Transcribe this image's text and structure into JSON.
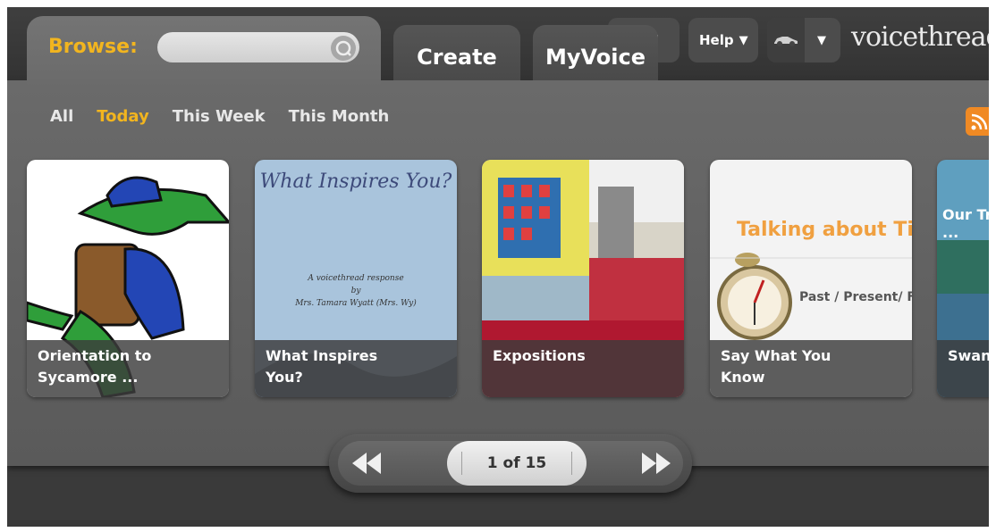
{
  "header": {
    "browse_label": "Browse:",
    "search_value": "",
    "tabs": [
      {
        "label": "Create"
      },
      {
        "label": "MyVoice"
      }
    ],
    "hidden_pill_fragment": "!",
    "help_label": "Help",
    "logo_text": "voicethread"
  },
  "filters": [
    {
      "label": "All",
      "active": false
    },
    {
      "label": "Today",
      "active": true
    },
    {
      "label": "This Week",
      "active": false
    },
    {
      "label": "This Month",
      "active": false
    }
  ],
  "threads": [
    {
      "title": "Orientation to\n Sycamore ...",
      "thumb": "alligator-mascot-thumbnail"
    },
    {
      "title": "What Inspires\n You?",
      "thumb": "what-inspires-you-slide",
      "slide_title": "What Inspires You?",
      "slide_sub1": "A voicethread response",
      "slide_sub2": "by",
      "slide_sub3": "Mrs. Tamara Wyatt (Mrs. Wy)"
    },
    {
      "title": "Expositions",
      "thumb": "classroom-store-photo"
    },
    {
      "title": "Say What You\n Know",
      "thumb": "talking-about-time-slide",
      "slide_title": "Talking about Tir",
      "slide_sub": "Past / Present/ F"
    },
    {
      "title": "Swan",
      "thumb": "lake-photo",
      "slide_title": "Our Tr",
      "slide_dots": "..."
    }
  ],
  "pager": {
    "label": "1 of 15"
  },
  "colors": {
    "accent": "#f2b51f",
    "panel": "#666666",
    "rss": "#f08a24"
  }
}
